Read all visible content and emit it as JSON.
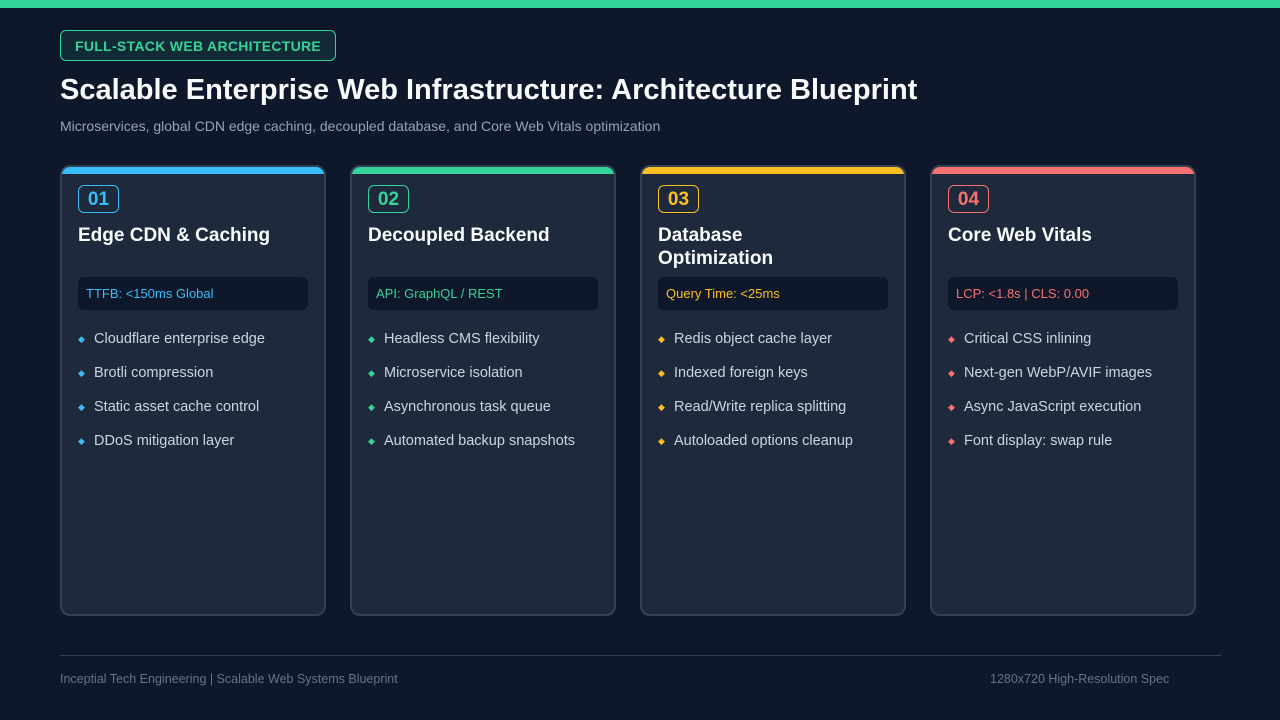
{
  "header": {
    "tag": "FULL-STACK WEB ARCHITECTURE",
    "title": "Scalable Enterprise Web Infrastructure: Architecture Blueprint",
    "subtitle": "Microservices, global CDN edge caching, decoupled database, and Core Web Vitals optimization"
  },
  "cards": [
    {
      "number": "01",
      "title": "Edge CDN & Caching",
      "metric": "TTFB: <150ms Global",
      "color": "#38bdf8",
      "bullet": "◆",
      "items": [
        "Cloudflare enterprise edge",
        "Brotli compression",
        "Static asset cache control",
        "DDoS mitigation layer"
      ]
    },
    {
      "number": "02",
      "title": "Decoupled Backend",
      "metric": "API: GraphQL / REST",
      "color": "#34d399",
      "bullet": "◆",
      "items": [
        "Headless CMS flexibility",
        "Microservice isolation",
        "Asynchronous task queue",
        "Automated backup snapshots"
      ]
    },
    {
      "number": "03",
      "title": "Database Optimization",
      "metric": "Query Time: <25ms",
      "color": "#fbbf24",
      "bullet": "◆",
      "items": [
        "Redis object cache layer",
        "Indexed foreign keys",
        "Read/Write replica splitting",
        "Autoloaded options cleanup"
      ]
    },
    {
      "number": "04",
      "title": "Core Web Vitals",
      "metric": "LCP: <1.8s | CLS: 0.00",
      "color": "#f87171",
      "bullet": "◆",
      "items": [
        "Critical CSS inlining",
        "Next-gen WebP/AVIF images",
        "Async JavaScript execution",
        "Font display: swap rule"
      ]
    }
  ],
  "footer": {
    "left": "Inceptial Tech Engineering | Scalable Web Systems Blueprint",
    "right": "1280x720 High-Resolution Spec"
  }
}
